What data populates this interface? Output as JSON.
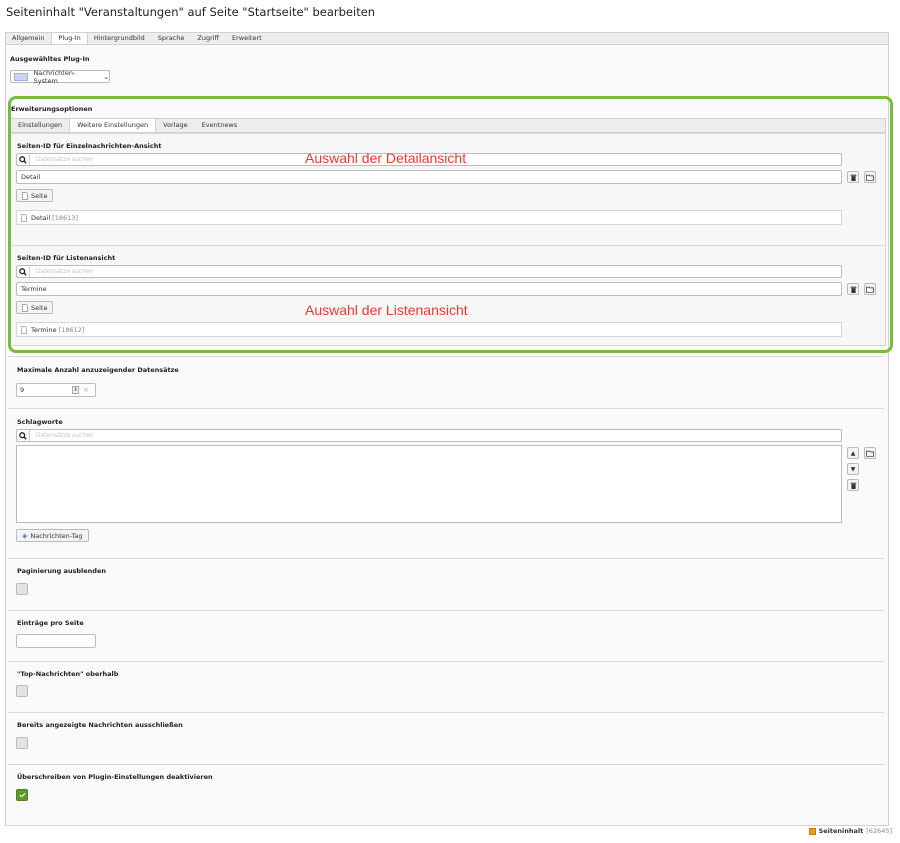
{
  "page": {
    "title": "Seiteninhalt \"Veranstaltungen\" auf Seite \"Startseite\" bearbeiten"
  },
  "main_tabs": [
    {
      "label": "Allgemein",
      "active": false
    },
    {
      "label": "Plug-In",
      "active": true
    },
    {
      "label": "Hintergrundbild",
      "active": false
    },
    {
      "label": "Sprache",
      "active": false
    },
    {
      "label": "Zugriff",
      "active": false
    },
    {
      "label": "Erweitert",
      "active": false
    }
  ],
  "plugin": {
    "label": "Ausgewähltes Plug-In",
    "selected": "Nachrichten-System"
  },
  "extended": {
    "label": "Erweiterungsoptionen",
    "tabs": [
      {
        "label": "Einstellungen",
        "active": false
      },
      {
        "label": "Weitere Einstellungen",
        "active": true
      },
      {
        "label": "Vorlage",
        "active": false
      },
      {
        "label": "Eventnews",
        "active": false
      }
    ],
    "detail": {
      "label": "Seiten-ID für Einzelnachrichten-Ansicht",
      "search_placeholder": "Datensätze suchen",
      "value": "Detail",
      "button": "Seite",
      "record_title": "Detail",
      "record_uid": "[18613]",
      "annotation": "Auswahl der Detailansicht"
    },
    "list": {
      "label": "Seiten-ID für Listenansicht",
      "search_placeholder": "Datensätze suchen",
      "value": "Termine",
      "button": "Seite",
      "record_title": "Termine",
      "record_uid": "[18612]",
      "annotation": "Auswahl der Listenansicht"
    }
  },
  "max_records": {
    "label": "Maximale Anzahl anzuzeigender Datensätze",
    "value": "9"
  },
  "tags": {
    "label": "Schlagworte",
    "search_placeholder": "Datensätze suchen",
    "button": "Nachrichten-Tag"
  },
  "pagination": {
    "label": "Paginierung ausblenden",
    "checked": false
  },
  "per_page": {
    "label": "Einträge pro Seite",
    "value": ""
  },
  "top_news": {
    "label": "\"Top-Nachrichten\" oberhalb",
    "checked": false
  },
  "exclude": {
    "label": "Bereits angezeigte Nachrichten ausschließen",
    "checked": false
  },
  "override": {
    "label": "Überschreiben von Plugin-Einstellungen deaktivieren",
    "checked": true
  },
  "footer": {
    "label": "Seiteninhalt",
    "uid": "[62645]"
  },
  "colors": {
    "annotation": "#ea3b2b",
    "highlight_frame": "#77bc3f",
    "checked": "#5c9a30"
  }
}
